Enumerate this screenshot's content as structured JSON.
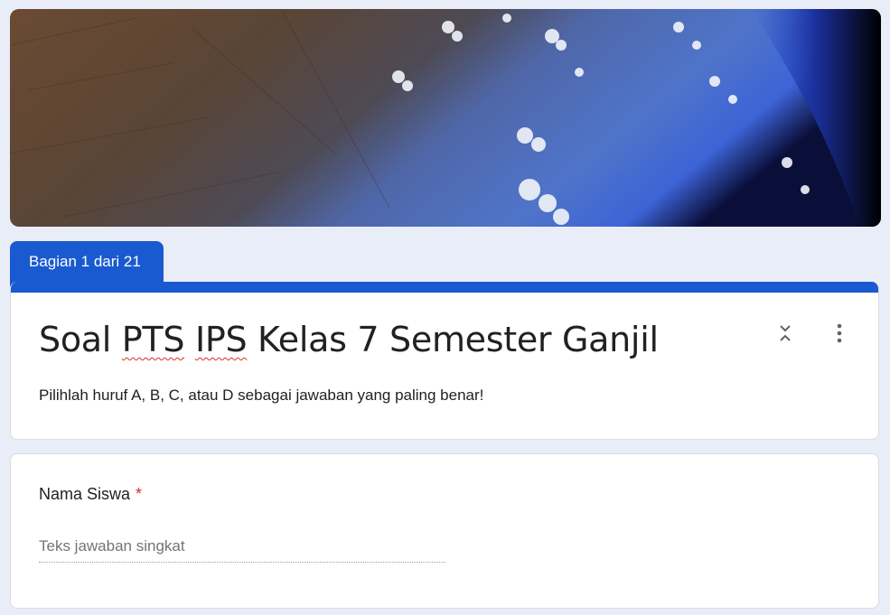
{
  "header_image": {
    "description_icon": "earth-from-space-banner"
  },
  "section": {
    "tab_label": "Bagian 1 dari 21"
  },
  "form": {
    "title_part1": "Soal ",
    "title_pts": "PTS",
    "title_mid": " ",
    "title_ips": "IPS",
    "title_part2": " Kelas 7 Semester Ganjil",
    "description": "Pilihlah huruf A, B, C, atau D sebagai jawaban yang paling benar!"
  },
  "question": {
    "label": "Nama Siswa",
    "required_mark": "*",
    "placeholder": "Teks jawaban singkat"
  },
  "colors": {
    "accent": "#1a5ad0",
    "required": "#d93025",
    "background": "#e8edf8"
  },
  "icons": {
    "collapse": "collapse-icon",
    "more": "more-vert-icon"
  }
}
